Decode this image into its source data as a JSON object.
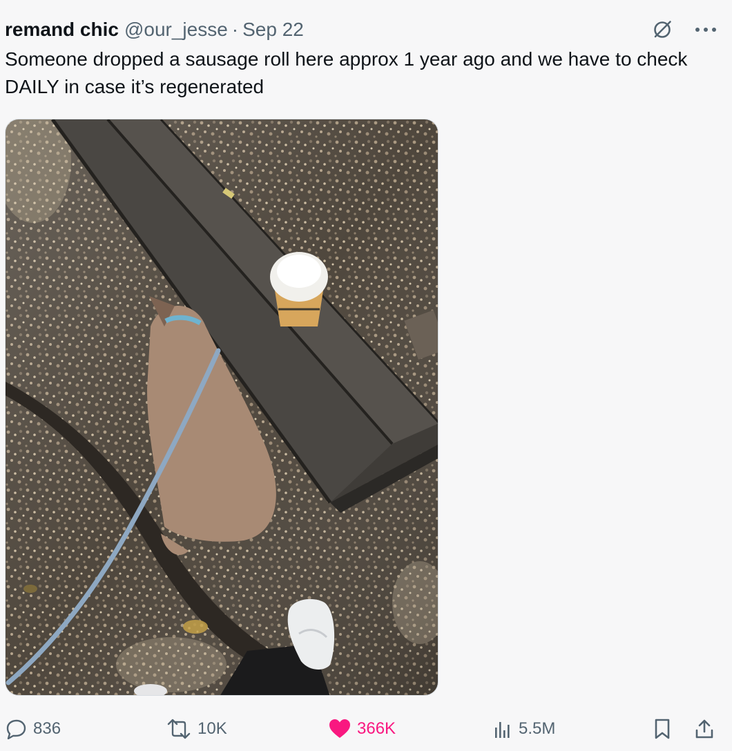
{
  "tweet": {
    "display_name": "remand chic",
    "handle": "@our_jesse",
    "separator": "·",
    "date": "Sep 22",
    "text": "Someone dropped a sausage roll here approx 1 year ago and we have to check DAILY in case it’s regenerated",
    "media": {
      "icon_semantics": "photo-of-dog-on-leash-beside-bench-with-coffee-cup"
    }
  },
  "actions": {
    "replies": "836",
    "reposts": "10K",
    "likes": "366K",
    "views": "5.5M"
  },
  "icons": {
    "grok": "grok-icon",
    "more": "more-icon",
    "reply": "reply-icon",
    "repost": "repost-icon",
    "like": "heart-icon",
    "views": "views-icon",
    "bookmark": "bookmark-icon",
    "share": "share-icon"
  },
  "colors": {
    "text": "#0f1419",
    "secondary": "#536471",
    "like": "#f91880",
    "background": "#f7f7f8"
  }
}
